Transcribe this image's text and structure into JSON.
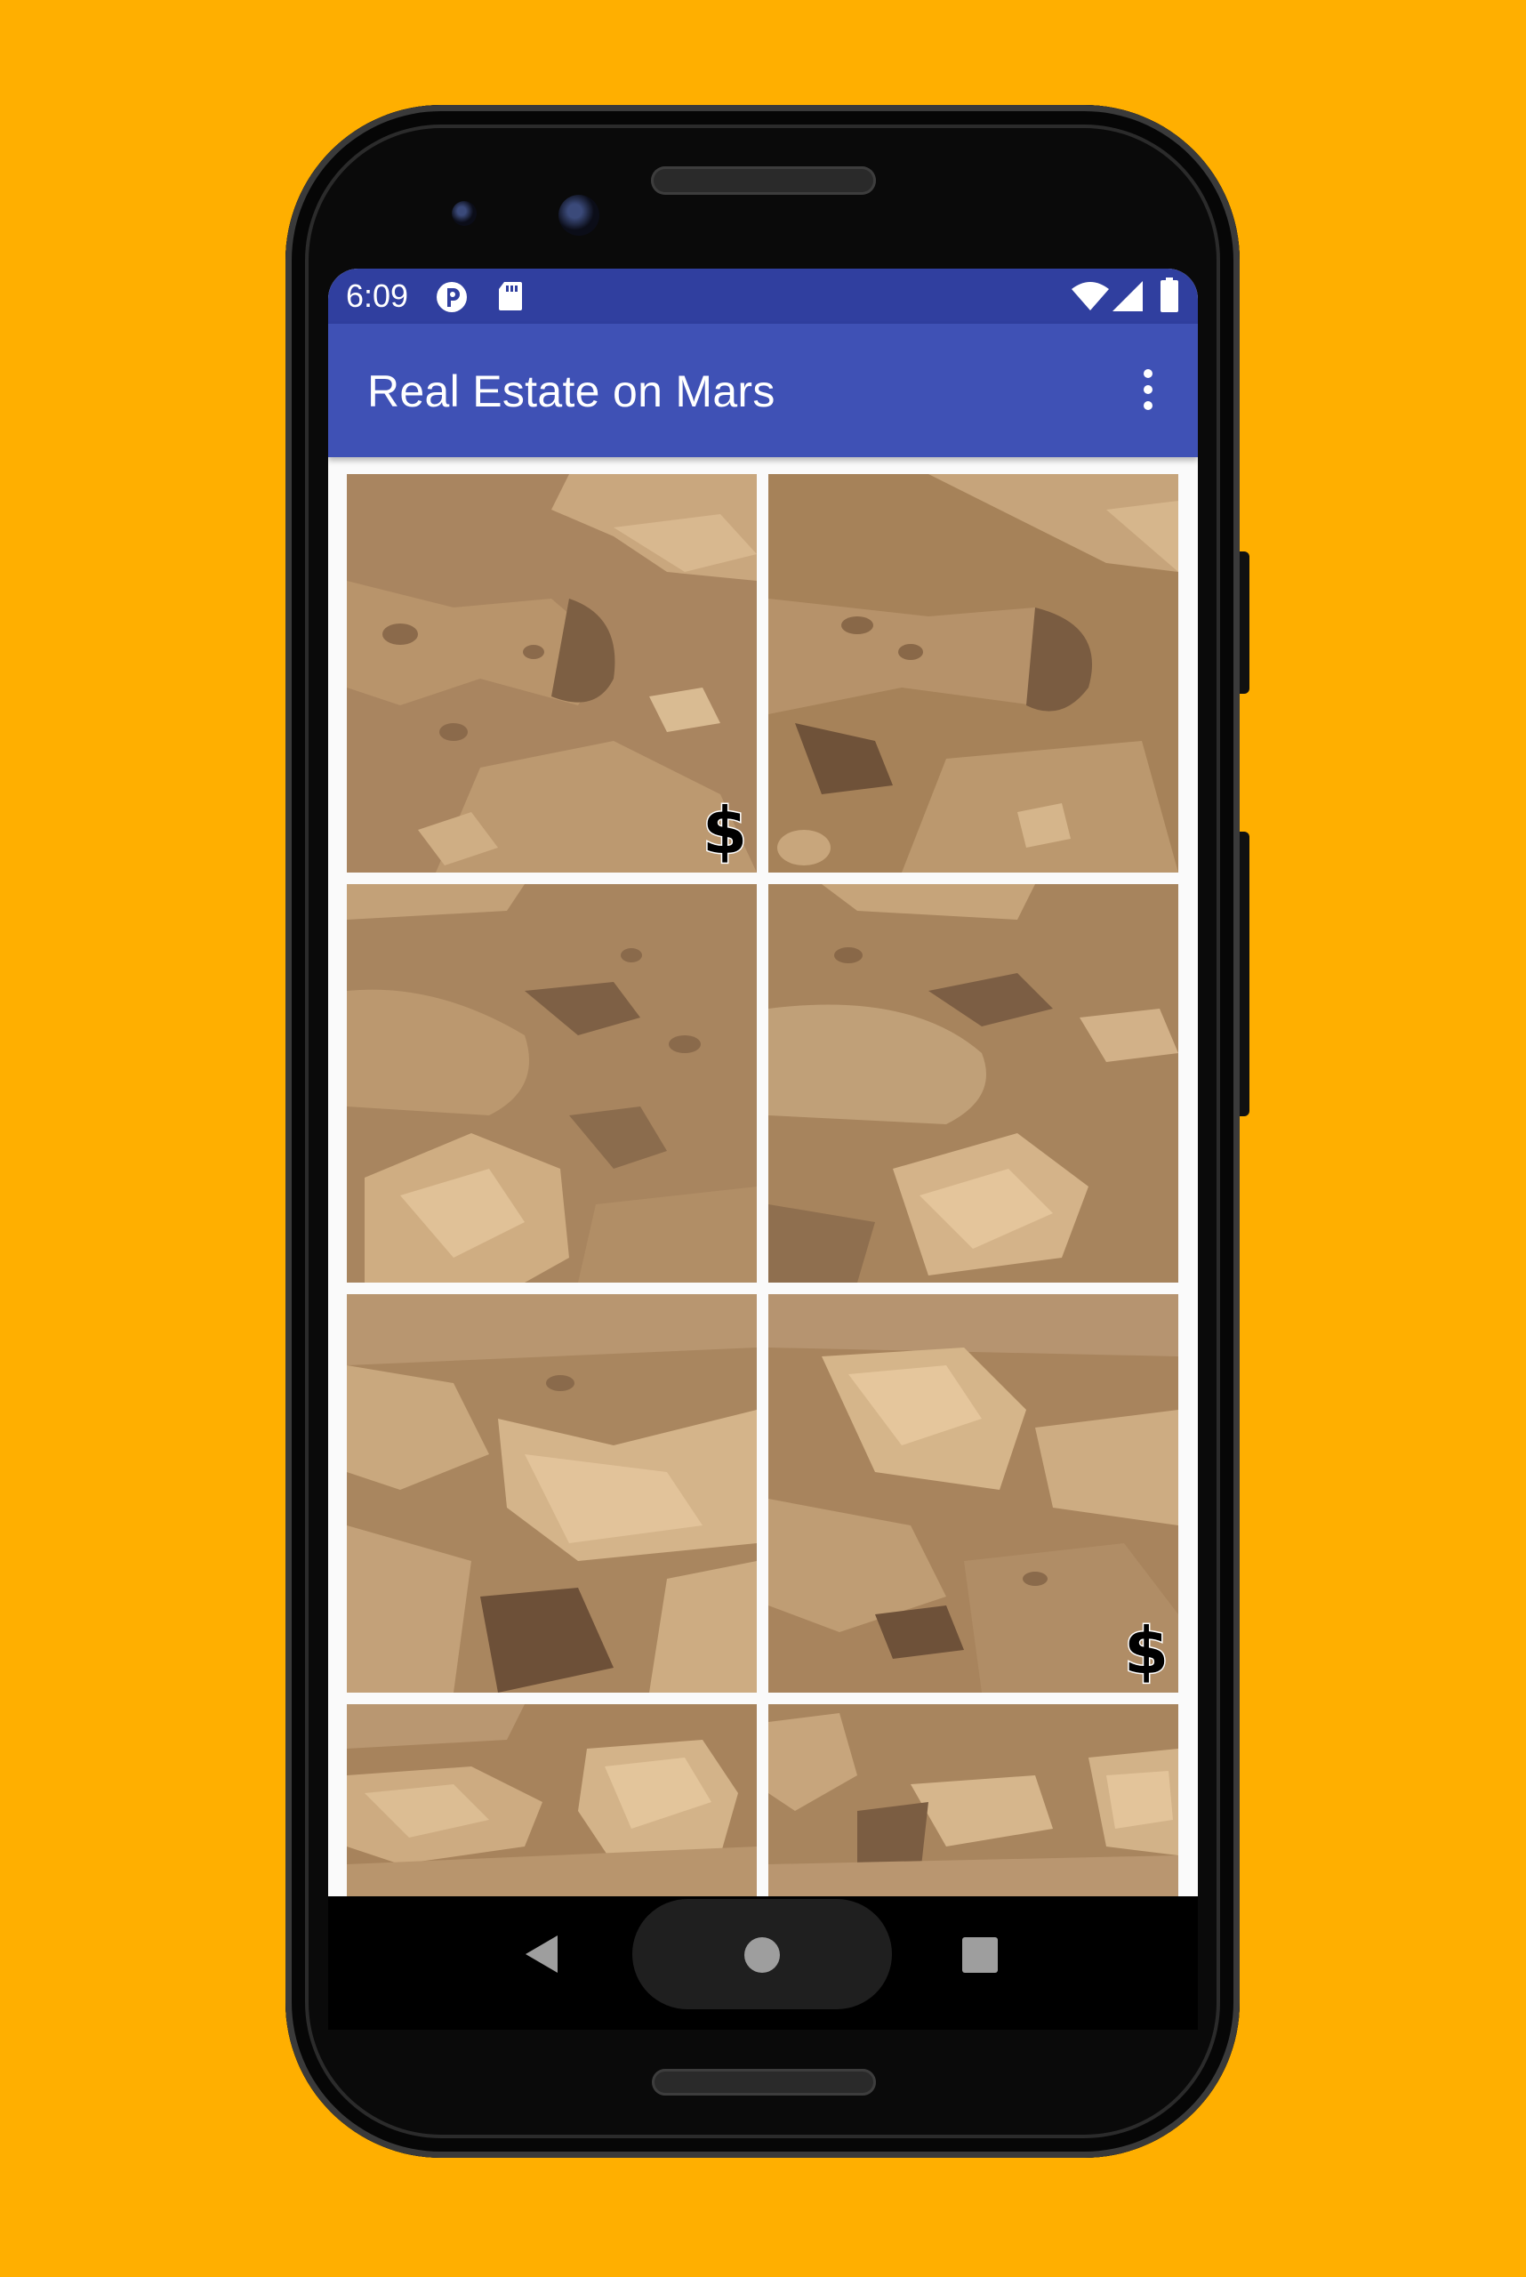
{
  "colors": {
    "background": "#FFAF00",
    "status_bar": "#303F9F",
    "app_bar": "#3F51B5",
    "screen_bg": "#FAFAFA",
    "tile_sand": "#A98560"
  },
  "status_bar": {
    "time": "6:09",
    "icons": [
      "notification-app-icon",
      "sd-card-icon",
      "wifi-icon",
      "cell-signal-icon",
      "battery-icon"
    ]
  },
  "app_bar": {
    "title": "Real Estate on Mars",
    "overflow_icon": "more-vert-icon"
  },
  "grid": {
    "columns": 2,
    "tiles": [
      {
        "name": "mars-tile-1",
        "for_sale": true,
        "price_icon": "dollar-icon"
      },
      {
        "name": "mars-tile-2",
        "for_sale": false
      },
      {
        "name": "mars-tile-3",
        "for_sale": false
      },
      {
        "name": "mars-tile-4",
        "for_sale": false
      },
      {
        "name": "mars-tile-5",
        "for_sale": false
      },
      {
        "name": "mars-tile-6",
        "for_sale": true,
        "price_icon": "dollar-icon"
      },
      {
        "name": "mars-tile-7",
        "for_sale": false
      },
      {
        "name": "mars-tile-8",
        "for_sale": false
      }
    ]
  },
  "nav_bar": {
    "icons": [
      "back-icon",
      "home-icon",
      "recents-icon"
    ]
  }
}
